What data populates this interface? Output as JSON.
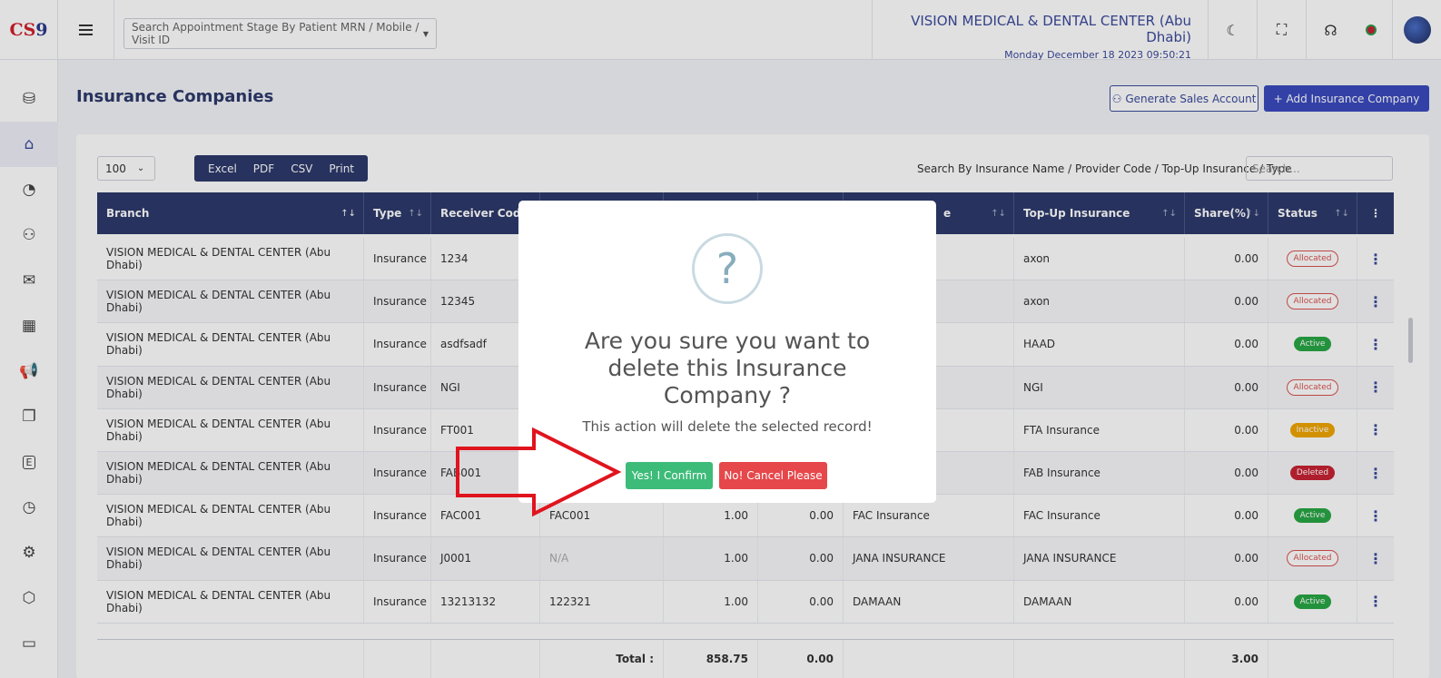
{
  "header": {
    "logo": {
      "part1": "CS",
      "part2": "9"
    },
    "search_placeholder": "Search Appointment Stage By Patient MRN / Mobile / Visit ID",
    "org_name": "VISION MEDICAL & DENTAL CENTER (Abu Dhabi)",
    "datetime": "Monday December 18 2023 09:50:21"
  },
  "page": {
    "title": "Insurance Companies",
    "generate_sales_label": "Generate Sales Account",
    "add_company_label": "+ Add Insurance Company"
  },
  "toolbar": {
    "page_size": "100",
    "exports": [
      "Excel",
      "PDF",
      "CSV",
      "Print"
    ],
    "search_label": "Search By Insurance Name / Provider Code / Top-Up Insurance / Type",
    "search_placeholder": "Search..."
  },
  "table": {
    "headers": [
      "Branch",
      "Type",
      "Receiver Code",
      "",
      "",
      "",
      "e",
      "Top-Up Insurance",
      "Share(%)",
      "Status"
    ],
    "rows": [
      {
        "branch": "VISION MEDICAL & DENTAL CENTER (Abu Dhabi)",
        "type": "Insurance",
        "receiver": "1234",
        "col4": "",
        "col5": "",
        "col6": "",
        "col7": "",
        "topup": "axon",
        "share": "0.00",
        "status": "Allocated"
      },
      {
        "branch": "VISION MEDICAL & DENTAL CENTER (Abu Dhabi)",
        "type": "Insurance",
        "receiver": "12345",
        "col4": "",
        "col5": "",
        "col6": "",
        "col7": "",
        "topup": "axon",
        "share": "0.00",
        "status": "Allocated"
      },
      {
        "branch": "VISION MEDICAL & DENTAL CENTER (Abu Dhabi)",
        "type": "Insurance",
        "receiver": "asdfsadf",
        "col4": "",
        "col5": "",
        "col6": "",
        "col7": "",
        "topup": "HAAD",
        "share": "0.00",
        "status": "Active"
      },
      {
        "branch": "VISION MEDICAL & DENTAL CENTER (Abu Dhabi)",
        "type": "Insurance",
        "receiver": "NGI",
        "col4": "",
        "col5": "",
        "col6": "",
        "col7": "",
        "topup": "NGI",
        "share": "0.00",
        "status": "Allocated"
      },
      {
        "branch": "VISION MEDICAL & DENTAL CENTER (Abu Dhabi)",
        "type": "Insurance",
        "receiver": "FT001",
        "col4": "",
        "col5": "",
        "col6": "",
        "col7": "",
        "topup": "FTA Insurance",
        "share": "0.00",
        "status": "Inactive"
      },
      {
        "branch": "VISION MEDICAL & DENTAL CENTER (Abu Dhabi)",
        "type": "Insurance",
        "receiver": "FAB001",
        "col4": "",
        "col5": "",
        "col6": "",
        "col7": "",
        "topup": "FAB Insurance",
        "share": "0.00",
        "status": "Deleted"
      },
      {
        "branch": "VISION MEDICAL & DENTAL CENTER (Abu Dhabi)",
        "type": "Insurance",
        "receiver": "FAC001",
        "col4": "FAC001",
        "col5": "1.00",
        "col6": "0.00",
        "col7": "FAC Insurance",
        "topup": "FAC Insurance",
        "share": "0.00",
        "status": "Active"
      },
      {
        "branch": "VISION MEDICAL & DENTAL CENTER (Abu Dhabi)",
        "type": "Insurance",
        "receiver": "J0001",
        "col4": "N/A",
        "col5": "1.00",
        "col6": "0.00",
        "col7": "JANA INSURANCE",
        "topup": "JANA INSURANCE",
        "share": "0.00",
        "status": "Allocated"
      },
      {
        "branch": "VISION MEDICAL & DENTAL CENTER (Abu Dhabi)",
        "type": "Insurance",
        "receiver": "13213132",
        "col4": "122321",
        "col5": "1.00",
        "col6": "0.00",
        "col7": "DAMAAN",
        "topup": "DAMAAN",
        "share": "0.00",
        "status": "Active"
      }
    ],
    "footer": {
      "total_label": "Total :",
      "total1": "858.75",
      "total2": "0.00",
      "share_total": "3.00"
    }
  },
  "modal": {
    "icon_text": "?",
    "title": "Are you sure you want to delete this Insurance Company ?",
    "text": "This action will delete the selected record!",
    "confirm_label": "Yes! I Confirm",
    "cancel_label": "No! Cancel Please"
  },
  "colors": {
    "primary": "#2d3a6c",
    "confirm": "#3dbb79",
    "cancel": "#e5474b",
    "arrow": "#e0141e"
  }
}
